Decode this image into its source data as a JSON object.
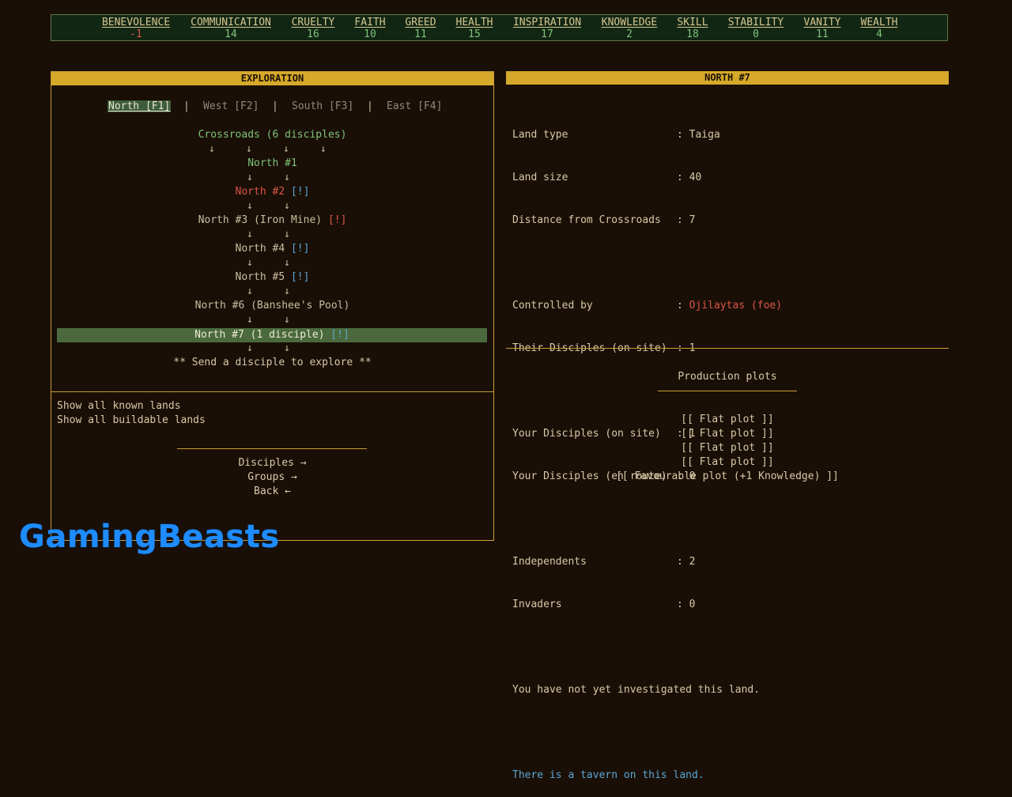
{
  "stats": [
    {
      "name": "BENEVOLENCE",
      "value": "-1"
    },
    {
      "name": "COMMUNICATION",
      "value": "14"
    },
    {
      "name": "CRUELTY",
      "value": "16"
    },
    {
      "name": "FAITH",
      "value": "10"
    },
    {
      "name": "GREED",
      "value": "11"
    },
    {
      "name": "HEALTH",
      "value": "15"
    },
    {
      "name": "INSPIRATION",
      "value": "17"
    },
    {
      "name": "KNOWLEDGE",
      "value": "2"
    },
    {
      "name": "SKILL",
      "value": "18"
    },
    {
      "name": "STABILITY",
      "value": "0"
    },
    {
      "name": "VANITY",
      "value": "11"
    },
    {
      "name": "WEALTH",
      "value": "4"
    }
  ],
  "exploration": {
    "title": "EXPLORATION",
    "tabs": [
      {
        "label": "North [F1]"
      },
      {
        "label": "West [F2]"
      },
      {
        "label": "South [F3]"
      },
      {
        "label": "East [F4]"
      }
    ],
    "separator": "|",
    "crossroads": "Crossroads (6 disciples)",
    "nodes": [
      {
        "label": "North #1",
        "flag": ""
      },
      {
        "label": "North #2",
        "flag": "[!]"
      },
      {
        "label": "North #3 (Iron Mine)",
        "flag": "[!]"
      },
      {
        "label": "North #4",
        "flag": "[!]"
      },
      {
        "label": "North #5",
        "flag": "[!]"
      },
      {
        "label": "North #6 (Banshee's Pool)",
        "flag": ""
      },
      {
        "label": "North #7 (1 disciple)",
        "flag": "[!]"
      }
    ],
    "arrow": "↓",
    "send": "** Send a disciple to explore **",
    "links": [
      "Show all known lands",
      "Show all buildable lands"
    ],
    "nav": [
      "Disciples →",
      "Groups →",
      "Back ←"
    ]
  },
  "detail": {
    "title": "NORTH #7",
    "rows": [
      {
        "key": "Land type",
        "sep": ":",
        "value": "Taiga"
      },
      {
        "key": "Land size",
        "sep": ":",
        "value": "40"
      },
      {
        "key": "Distance from Crossroads",
        "sep": ":",
        "value": "7"
      },
      {
        "key": "Controlled by",
        "sep": ":",
        "value": "Ojilaytas (foe)"
      },
      {
        "key": "Their Disciples (on site)",
        "sep": ":",
        "value": "1"
      },
      {
        "key": "Your Disciples (on site)",
        "sep": ":",
        "value": "1"
      },
      {
        "key": "Your Disciples (en route)",
        "sep": ":",
        "value": "0"
      },
      {
        "key": "Independents",
        "sep": ":",
        "value": "2"
      },
      {
        "key": "Invaders",
        "sep": ":",
        "value": "0"
      }
    ],
    "note": "You have not yet investigated this land.",
    "tavern": "There is a tavern on this land.",
    "production_title": "Production plots",
    "plots": [
      "[[ Flat plot ]]",
      "[[ Flat plot ]]",
      "[[ Flat plot ]]",
      "[[ Flat plot ]]",
      "[[ Favourable plot (+1 Knowledge) ]]"
    ]
  },
  "watermark": "GamingBeasts"
}
